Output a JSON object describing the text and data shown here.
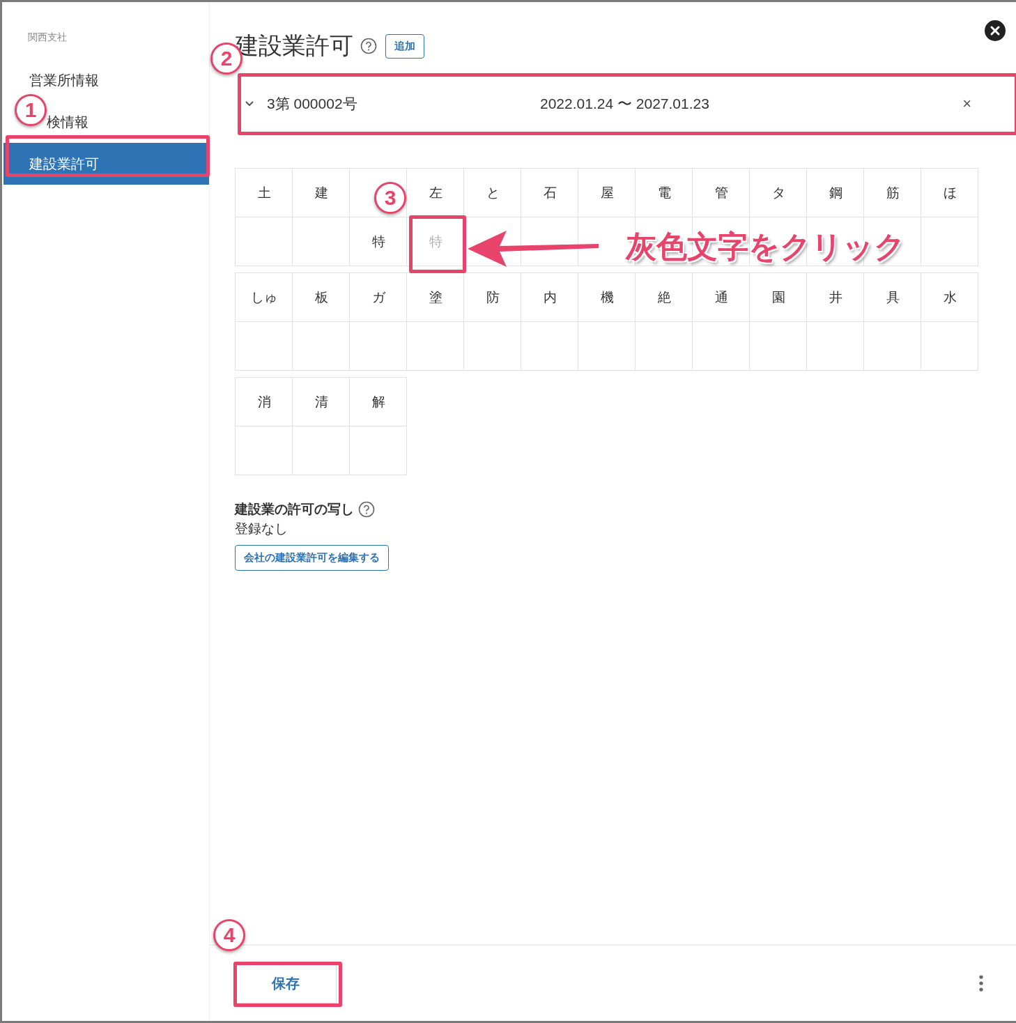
{
  "sidebar": {
    "heading": "関西支社",
    "items": [
      {
        "label": "営業所情報",
        "selected": false
      },
      {
        "label": "検情報",
        "selected": false
      },
      {
        "label": "建設業許可",
        "selected": true
      }
    ]
  },
  "header": {
    "title": "建設業許可",
    "add_button": "追加"
  },
  "permits": [
    {
      "number": "3第 000002号",
      "period": "2022.01.24 〜 2027.01.23",
      "remove": "×"
    }
  ],
  "trades": [
    [
      {
        "label": "土"
      },
      {
        "label": "建"
      },
      {
        "mark": "特",
        "active": true
      },
      {
        "label": "左",
        "mark": "特",
        "active": false
      },
      {
        "label": "と"
      },
      {
        "label": "石"
      },
      {
        "label": "屋"
      },
      {
        "label": "電"
      },
      {
        "label": "管"
      },
      {
        "label": "タ"
      },
      {
        "label": "鋼"
      },
      {
        "label": "筋"
      },
      {
        "label": "ほ"
      }
    ],
    [
      {
        "label": "しゅ"
      },
      {
        "label": "板"
      },
      {
        "label": "ガ"
      },
      {
        "label": "塗"
      },
      {
        "label": "防"
      },
      {
        "label": "内"
      },
      {
        "label": "機"
      },
      {
        "label": "絶"
      },
      {
        "label": "通"
      },
      {
        "label": "園"
      },
      {
        "label": "井"
      },
      {
        "label": "具"
      },
      {
        "label": "水"
      }
    ],
    [
      {
        "label": "消"
      },
      {
        "label": "清"
      },
      {
        "label": "解"
      }
    ]
  ],
  "copy_section": {
    "title": "建設業の許可の写し",
    "value": "登録なし",
    "edit_button": "会社の建設業許可を編集する"
  },
  "footer": {
    "save_button": "保存"
  },
  "annotations": {
    "steps": [
      "1",
      "2",
      "3",
      "4"
    ],
    "callout": "灰色文字をクリック"
  }
}
